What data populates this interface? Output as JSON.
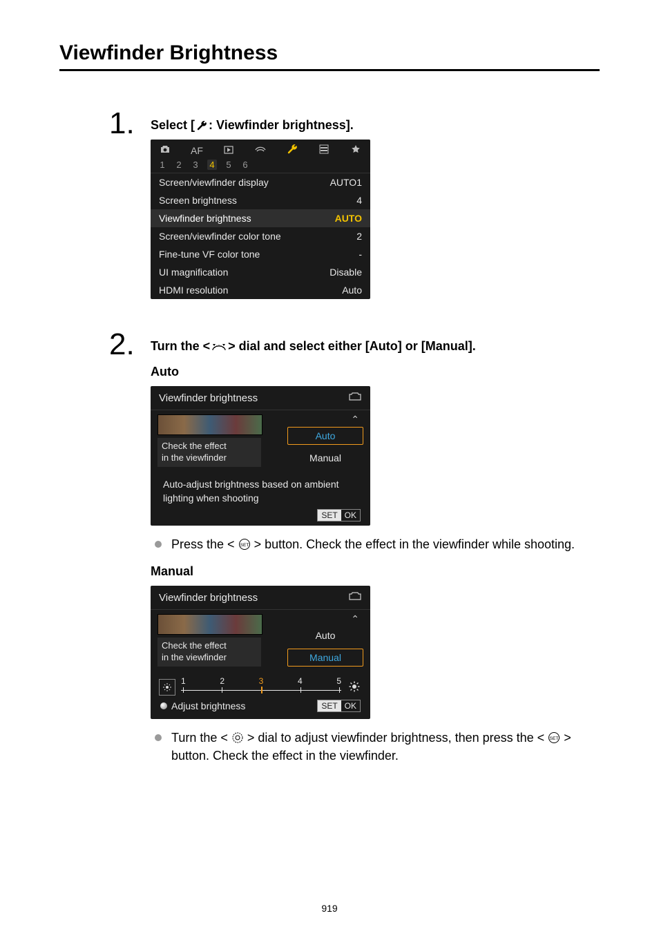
{
  "title": "Viewfinder Brightness",
  "page_number": "919",
  "step1": {
    "number": "1.",
    "label_pre": "Select [",
    "label_post": ": Viewfinder brightness].",
    "wrench_icon": "wrench-icon"
  },
  "menu_screenshot": {
    "tabs": {
      "camera": "camera-icon",
      "af_label": "AF",
      "play": "play-icon",
      "net": "network-icon",
      "setup": "wrench-icon",
      "custom": "grid-icon",
      "star": "star-icon"
    },
    "subtabs": [
      "1",
      "2",
      "3",
      "4",
      "5",
      "6"
    ],
    "subtab_active_index": 3,
    "rows": [
      {
        "label": "Screen/viewfinder display",
        "value": "AUTO1"
      },
      {
        "label": "Screen brightness",
        "value": "4"
      },
      {
        "label": "Viewfinder brightness",
        "value": "AUTO",
        "selected": true
      },
      {
        "label": "Screen/viewfinder color tone",
        "value": "2"
      },
      {
        "label": "Fine-tune VF color tone",
        "value": "-"
      },
      {
        "label": "UI magnification",
        "value": "Disable"
      },
      {
        "label": "HDMI resolution",
        "value": "Auto"
      }
    ]
  },
  "step2": {
    "number": "2.",
    "label_pre": "Turn the < ",
    "label_mid": " > dial and select either [Auto] or [Manual].",
    "auto_heading": "Auto",
    "manual_heading": "Manual"
  },
  "vf_auto": {
    "title": "Viewfinder brightness",
    "check_line1": "Check the effect",
    "check_line2": "in the viewfinder",
    "opt_auto": "Auto",
    "opt_manual": "Manual",
    "desc": "Auto-adjust brightness based on ambient lighting when shooting",
    "set": "SET",
    "ok": "OK"
  },
  "auto_bullet_pre": "Press the < ",
  "auto_bullet_post": " > button. Check the effect in the viewfinder while shooting.",
  "vf_manual": {
    "title": "Viewfinder brightness",
    "check_line1": "Check the effect",
    "check_line2": "in the viewfinder",
    "opt_auto": "Auto",
    "opt_manual": "Manual",
    "slider_values": [
      "1",
      "2",
      "3",
      "4",
      "5"
    ],
    "slider_current_index": 2,
    "adjust_label": "Adjust brightness",
    "set": "SET",
    "ok": "OK"
  },
  "manual_bullet_pre": "Turn the < ",
  "manual_bullet_mid": " > dial to adjust viewfinder brightness, then press the < ",
  "manual_bullet_post": " > button. Check the effect in the viewfinder."
}
